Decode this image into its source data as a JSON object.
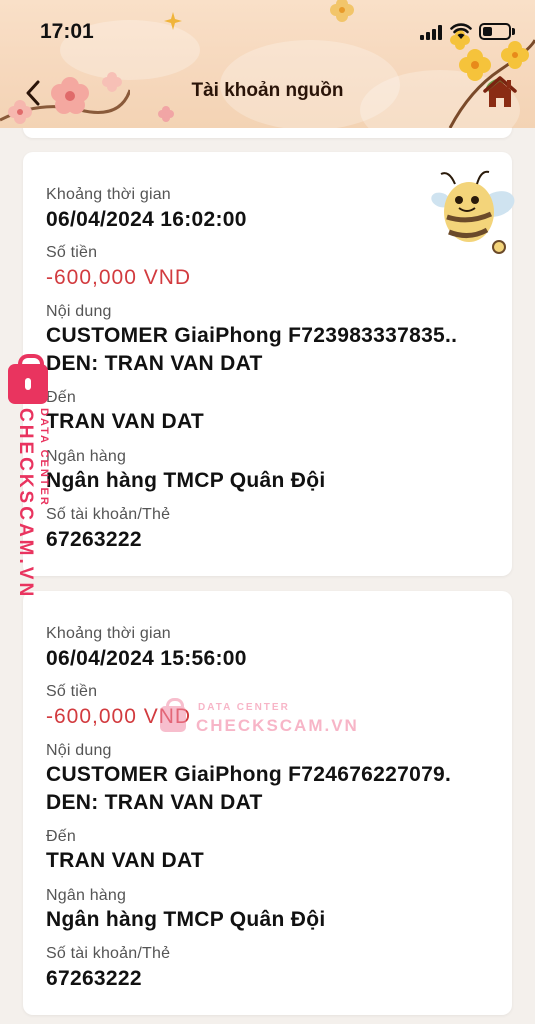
{
  "status_bar": {
    "time": "17:01"
  },
  "header": {
    "title": "Tài khoản nguồn"
  },
  "labels": {
    "time": "Khoảng thời gian",
    "amount": "Số tiền",
    "content": "Nội dung",
    "to": "Đến",
    "bank": "Ngân hàng",
    "account": "Số tài khoản/Thẻ"
  },
  "transactions": [
    {
      "time": "06/04/2024 16:02:00",
      "amount": "-600,000 VND",
      "content": "CUSTOMER GiaiPhong F723983337835.. DEN: TRAN VAN DAT",
      "to": "TRAN VAN DAT",
      "bank": "Ngân hàng TMCP Quân Đội",
      "account": "67263222"
    },
    {
      "time": "06/04/2024 15:56:00",
      "amount": "-600,000 VND",
      "content": "CUSTOMER GiaiPhong F724676227079. DEN: TRAN VAN DAT",
      "to": "TRAN VAN DAT",
      "bank": "Ngân hàng TMCP Quân Đội",
      "account": "67263222"
    }
  ],
  "watermark": {
    "brand": "CHECKSCAM.VN",
    "subtitle": "DATA CENTER"
  },
  "colors": {
    "amount": "#d23b3f",
    "watermark": "#e9345f",
    "header_bg": "#f6d8bd"
  }
}
